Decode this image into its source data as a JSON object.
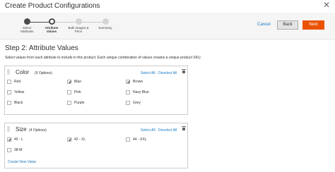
{
  "modal": {
    "title": "Create Product Configurations",
    "close_label": "✕"
  },
  "wizard": {
    "steps": [
      {
        "label_line1": "Select",
        "label_line2": "Attributes",
        "state": "done"
      },
      {
        "label_line1": "Attribute",
        "label_line2": "Values",
        "state": "active"
      },
      {
        "label_line1": "Bulk Images &",
        "label_line2": "Price",
        "state": "todo"
      },
      {
        "label_line1": "Summary",
        "label_line2": "",
        "state": "todo"
      }
    ],
    "cancel_label": "Cancel",
    "back_label": "Back",
    "next_label": "Next"
  },
  "step": {
    "heading": "Step 2: Attribute Values",
    "description": "Select values from each attribute to include in this product. Each unique combination of values creates a unique product SKU."
  },
  "color_attribute": {
    "name": "Color",
    "count": "(9 Options)",
    "select_all": "Select All",
    "separator": "·",
    "deselect_all": "Deselect All",
    "options": [
      {
        "label": "Red",
        "checked": false
      },
      {
        "label": "Blue",
        "checked": true
      },
      {
        "label": "Brown",
        "checked": true
      },
      {
        "label": "Yellow",
        "checked": false
      },
      {
        "label": "Pink",
        "checked": false
      },
      {
        "label": "Navy Blue",
        "checked": false
      },
      {
        "label": "Black",
        "checked": false
      },
      {
        "label": "Purple",
        "checked": false
      },
      {
        "label": "Grey",
        "checked": false
      }
    ]
  },
  "size_attribute": {
    "name": "Size",
    "count": "(4 Options)",
    "select_all": "Select All",
    "separator": "·",
    "deselect_all": "Deselect All",
    "options": [
      {
        "label": "40 - L",
        "checked": true
      },
      {
        "label": "42 - XL",
        "checked": true
      },
      {
        "label": "44 - XXL",
        "checked": false
      },
      {
        "label": "38-M",
        "checked": false
      }
    ],
    "create_new_value": "Create New Value"
  }
}
